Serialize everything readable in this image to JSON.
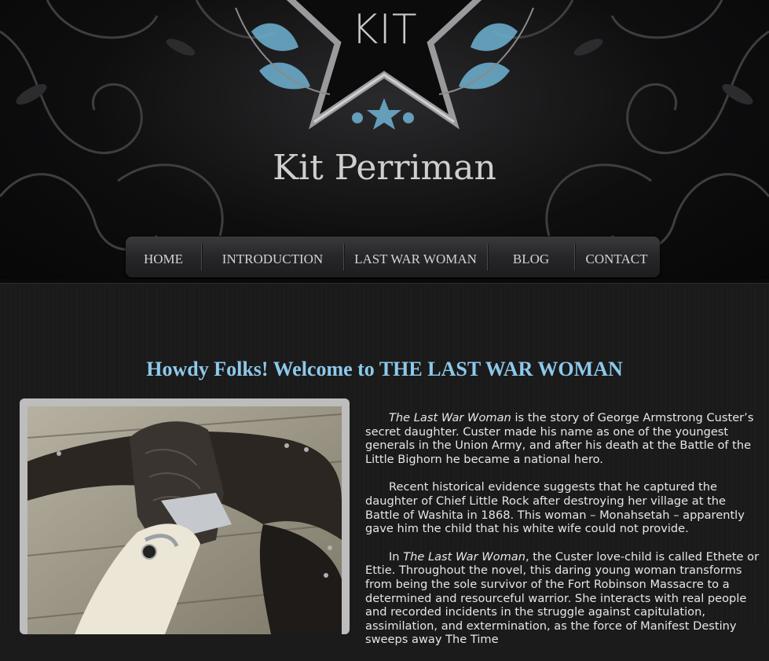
{
  "header": {
    "logo_text": "KIT",
    "site_title": "Kit Perriman"
  },
  "nav": {
    "items": [
      {
        "label": "HOME"
      },
      {
        "label": "INTRODUCTION"
      },
      {
        "label": "LAST WAR WOMAN"
      },
      {
        "label": "BLOG"
      },
      {
        "label": "CONTACT"
      }
    ]
  },
  "main": {
    "headline": "Howdy Folks! Welcome to THE LAST WAR WOMAN",
    "paragraphs": [
      {
        "title": "The Last War Woman",
        "text": " is the story of George Armstrong Custer’s secret daughter. Custer made his name as one of the youngest generals in the Union Army, and after his death at the Battle of the Little Bighorn he became a national hero."
      },
      {
        "text": "Recent historical evidence suggests that he captured the daughter of Chief Little Rock after destroying her village at the Battle of Washita in 1868. This woman – Monahsetah – apparently gave him the child that his white wife could not provide."
      },
      {
        "lead": "In ",
        "title": "The Last War Woman",
        "text": ", the Custer love-child is called Ethete or Ettie. Throughout the novel, this daring young woman transforms from being the sole survivor of the Fort Robinson Massacre to a determined and resourceful warrior. She interacts with real people and recorded incidents in the struggle against capitulation, assimilation, and extermination, as the force of Manifest Destiny sweeps away The Time"
      }
    ]
  },
  "colors": {
    "accent": "#8dc9ea",
    "background": "#1b1b1c"
  }
}
